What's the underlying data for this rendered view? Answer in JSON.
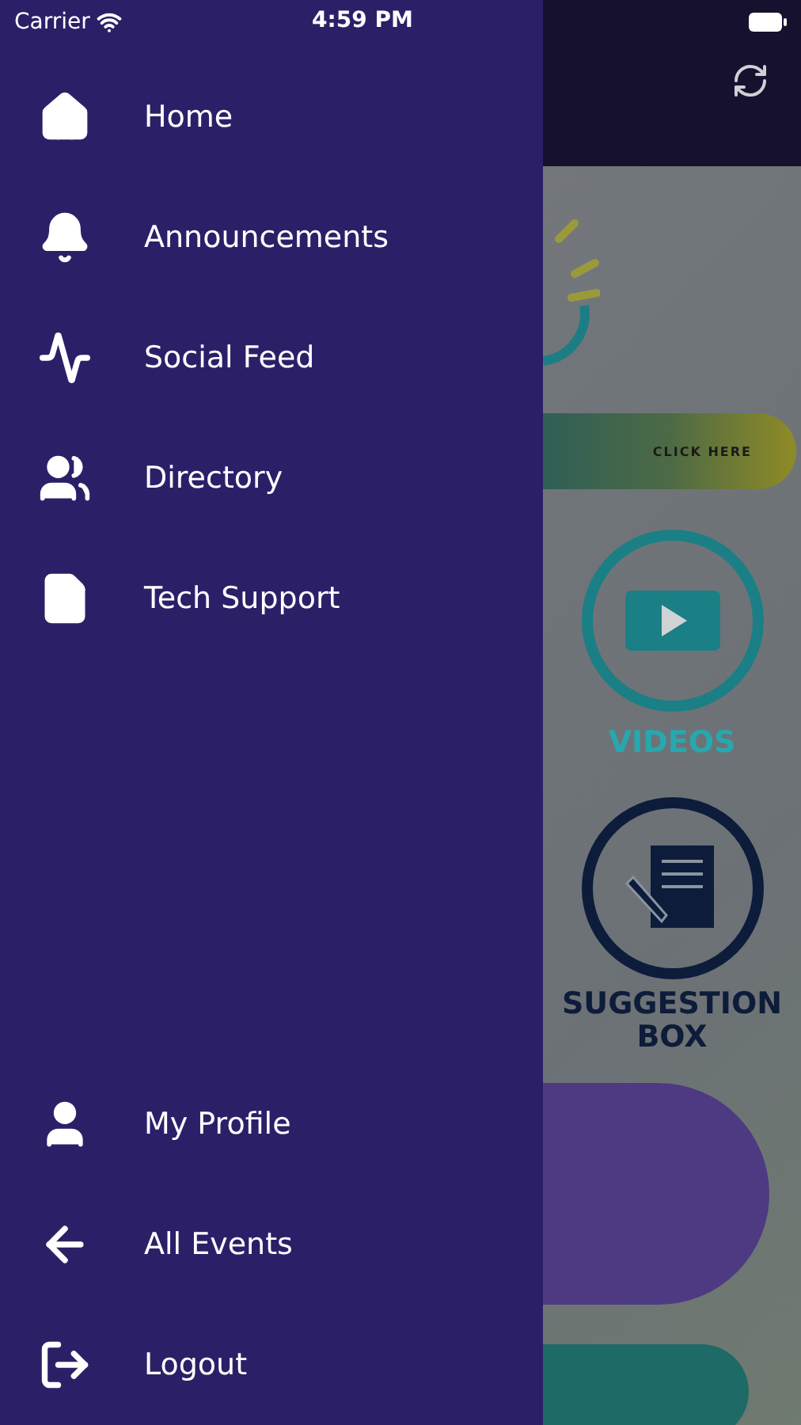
{
  "status_bar": {
    "carrier": "Carrier",
    "time": "4:59 PM"
  },
  "drawer": {
    "main_items": [
      {
        "label": "Home"
      },
      {
        "label": "Announcements"
      },
      {
        "label": "Social Feed"
      },
      {
        "label": "Directory"
      },
      {
        "label": "Tech Support"
      }
    ],
    "bottom_items": [
      {
        "label": "My Profile"
      },
      {
        "label": "All Events"
      },
      {
        "label": "Logout"
      }
    ]
  },
  "background_app": {
    "banner_button": "CLICK HERE",
    "tiles": [
      {
        "label": "VIDEOS"
      },
      {
        "label": "SUGGESTION BOX"
      }
    ]
  }
}
